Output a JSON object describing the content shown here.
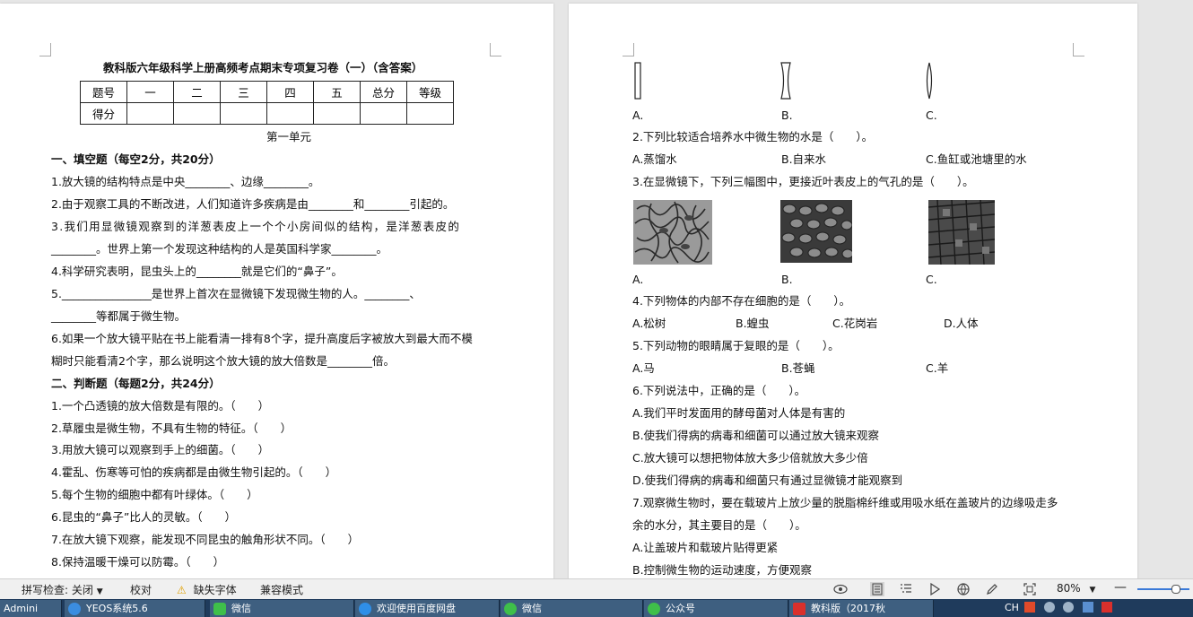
{
  "left_page": {
    "title": "教科版六年级科学上册高频考点期末专项复习卷（一）（含答案）",
    "score_table": {
      "headers": [
        "题号",
        "一",
        "二",
        "三",
        "四",
        "五",
        "总分",
        "等级"
      ],
      "row2": [
        "得分",
        "",
        "",
        "",
        "",
        "",
        "",
        ""
      ]
    },
    "unit": "第一单元",
    "lines": [
      "一、填空题（每空2分，共20分）",
      "1.放大镜的结构特点是中央________、边缘________。",
      "2.由于观察工具的不断改进，人们知道许多疾病是由________和________引起的。",
      "3.我们用显微镜观察到的洋葱表皮上一个个小房间似的结构，是洋葱表皮的",
      "________。世界上第一个发现这种结构的人是英国科学家________。",
      "4.科学研究表明，昆虫头上的________就是它们的“鼻子”。",
      "5.________________是世界上首次在显微镜下发现微生物的人。________、",
      "________等都属于微生物。",
      "6.如果一个放大镜平贴在书上能看清一排有8个字，提升高度后字被放大到最大而不模",
      "糊时只能看清2个字，那么说明这个放大镜的放大倍数是________倍。",
      "二、判断题（每题2分，共24分）",
      "1.一个凸透镜的放大倍数是有限的。（　　）",
      "2.草履虫是微生物，不具有生物的特征。（　　）",
      "3.用放大镜可以观察到手上的细菌。（　　）",
      "4.霍乱、伤寒等可怕的疾病都是由微生物引起的。（　　）",
      "5.每个生物的细胞中都有叶绿体。（　　）",
      "6.昆虫的“鼻子”比人的灵敏。（　　）",
      "7.在放大镜下观察，能发现不同昆虫的触角形状不同。（　　）",
      "8.保持温暖干燥可以防霉。（　　）"
    ]
  },
  "right_page": {
    "q1_options": [
      "A.",
      "B.",
      "C."
    ],
    "q2": "2.下列比较适合培养水中微生物的水是（　　）。",
    "q2_options": [
      "A.蒸馏水",
      "B.自来水",
      "C.鱼缸或池塘里的水"
    ],
    "q3": "3.在显微镜下，下列三幅图中，更接近叶表皮上的气孔的是（　　）。",
    "q3_options": [
      "A.",
      "B.",
      "C."
    ],
    "q4": "4.下列物体的内部不存在细胞的是（　　）。",
    "q4_options": [
      "A.松树",
      "B.蝗虫",
      "C.花岗岩",
      "D.人体"
    ],
    "q5": "5.下列动物的眼睛属于复眼的是（　　）。",
    "q5_options": [
      "A.马",
      "B.苍蝇",
      "C.羊"
    ],
    "q6": "6.下列说法中，正确的是（　　）。",
    "q6_options": [
      "A.我们平时发面用的酵母菌对人体是有害的",
      "B.使我们得病的病毒和细菌可以通过放大镜来观察",
      "C.放大镜可以想把物体放大多少倍就放大多少倍",
      "D.使我们得病的病毒和细菌只有通过显微镜才能观察到"
    ],
    "q7_line1": "7.观察微生物时，要在载玻片上放少量的脱脂棉纤维或用吸水纸在盖玻片的边缘吸走多",
    "q7_line2": "余的水分，其主要目的是（　　）。",
    "q7_options": [
      "A.让盖玻片和载玻片贴得更紧",
      "B.控制微生物的运动速度，方便观察"
    ]
  },
  "statusbar": {
    "spellcheck": "拼写检查: 关闭",
    "proofread": "校对",
    "missing_fonts": "缺失字体",
    "compat_mode": "兼容模式",
    "zoom": "80%"
  },
  "taskbar": {
    "items": [
      "Admini",
      "YEOS系统5.6",
      "微信",
      "欢迎使用百度网盘",
      "微信",
      "公众号",
      "教科版（2017秋"
    ],
    "tray_text": "CH"
  }
}
